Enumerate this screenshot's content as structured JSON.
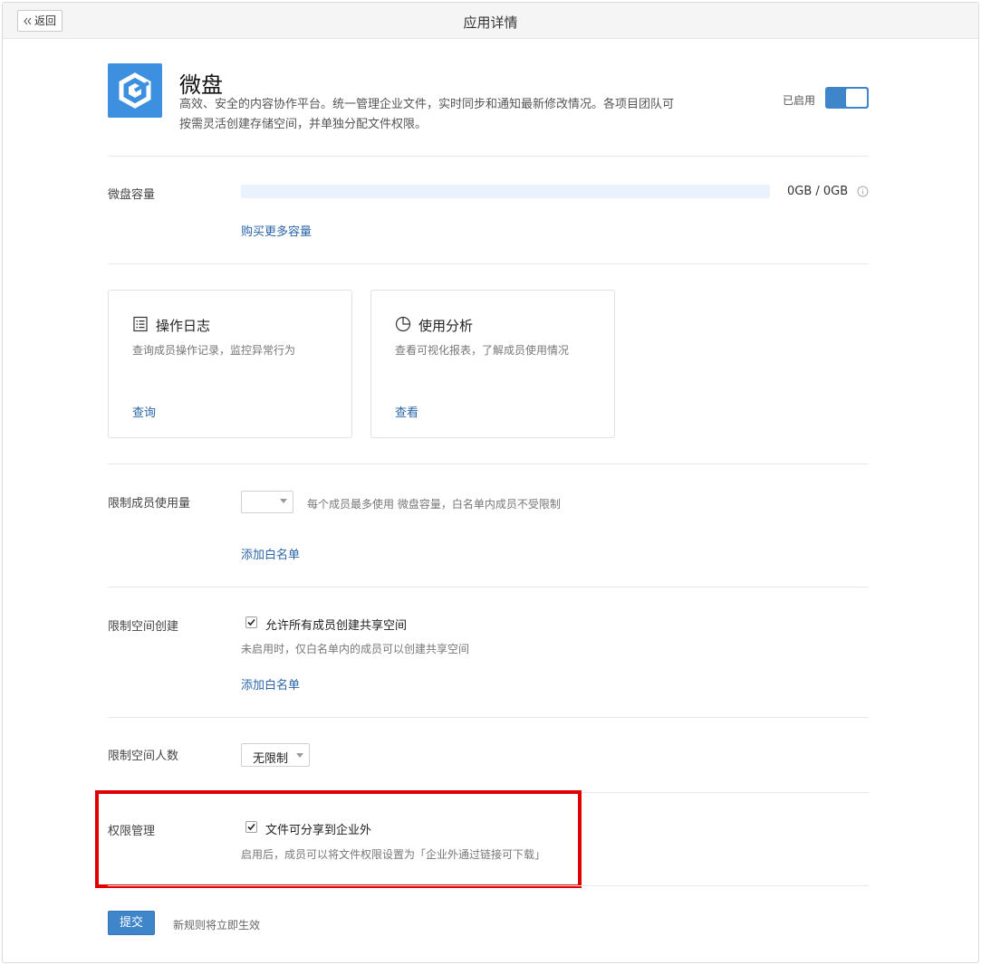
{
  "topbar": {
    "back_label": "返回",
    "title": "应用详情"
  },
  "app": {
    "name": "微盘",
    "desc_line1": "高效、安全的内容协作平台。统一管理企业文件，实时同步和通知最新修改情况。各项目团队可",
    "desc_line2": "按需灵活创建存储空间，并单独分配文件权限。",
    "status_label": "已启用",
    "enabled": true,
    "icon": "weipan-logo-icon",
    "brand_color": "#3d8fe0"
  },
  "capacity": {
    "label": "微盘容量",
    "value_text": "0GB / 0GB",
    "used_fraction": 0,
    "buy_more_link": "购买更多容量"
  },
  "cards": [
    {
      "icon": "list-icon",
      "title": "操作日志",
      "desc": "查询成员操作记录，监控异常行为",
      "link": "查询"
    },
    {
      "icon": "pie-chart-icon",
      "title": "使用分析",
      "desc": "查看可视化报表，了解成员使用情况",
      "link": "查看"
    }
  ],
  "member_limit": {
    "label": "限制成员使用量",
    "select_value": "",
    "hint": "每个成员最多使用 微盘容量，白名单内成员不受限制",
    "whitelist_link": "添加白名单"
  },
  "space_create": {
    "label": "限制空间创建",
    "checkbox_label": "允许所有成员创建共享空间",
    "checked": true,
    "hint": "未启用时，仅白名单内的成员可以创建共享空间",
    "whitelist_link": "添加白名单"
  },
  "space_people": {
    "label": "限制空间人数",
    "select_value": "无限制"
  },
  "permission": {
    "label": "权限管理",
    "checkbox_label": "文件可分享到企业外",
    "checked": true,
    "hint": "启用后，成员可以将文件权限设置为「企业外通过链接可下载」"
  },
  "footer": {
    "submit_label": "提交",
    "submit_hint": "新规则将立即生效"
  },
  "colors": {
    "accent": "#3f85ca",
    "link": "#2b64a8",
    "highlight": "#e00000"
  }
}
